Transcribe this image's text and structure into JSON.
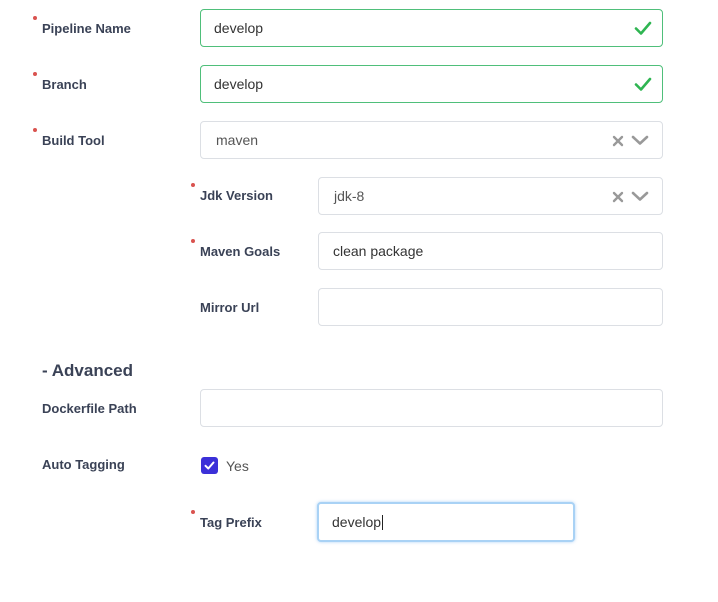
{
  "form": {
    "pipeline_name": {
      "label": "Pipeline Name",
      "value": "develop"
    },
    "branch": {
      "label": "Branch",
      "value": "develop"
    },
    "build_tool": {
      "label": "Build Tool",
      "value": "maven"
    },
    "jdk_version": {
      "label": "Jdk Version",
      "value": "jdk-8"
    },
    "maven_goals": {
      "label": "Maven Goals",
      "value": "clean package"
    },
    "mirror_url": {
      "label": "Mirror Url",
      "value": ""
    },
    "advanced": {
      "title": "- Advanced"
    },
    "dockerfile_path": {
      "label": "Dockerfile Path",
      "value": ""
    },
    "auto_tagging": {
      "label": "Auto Tagging",
      "checkbox_label": "Yes",
      "checked": true
    },
    "tag_prefix": {
      "label": "Tag Prefix",
      "value": "develop"
    }
  },
  "colors": {
    "required_marker": "#d9534f",
    "valid_border": "#4fbf7a",
    "valid_check": "#2fb552",
    "checkbox_fill": "#3b30d8",
    "focus_border": "#a9d2f5",
    "label_text": "#3a4256"
  },
  "icons": {
    "valid": "check-icon",
    "clear": "clear-x-icon",
    "dropdown": "chevron-down-icon",
    "checkbox": "checkmark-icon"
  }
}
